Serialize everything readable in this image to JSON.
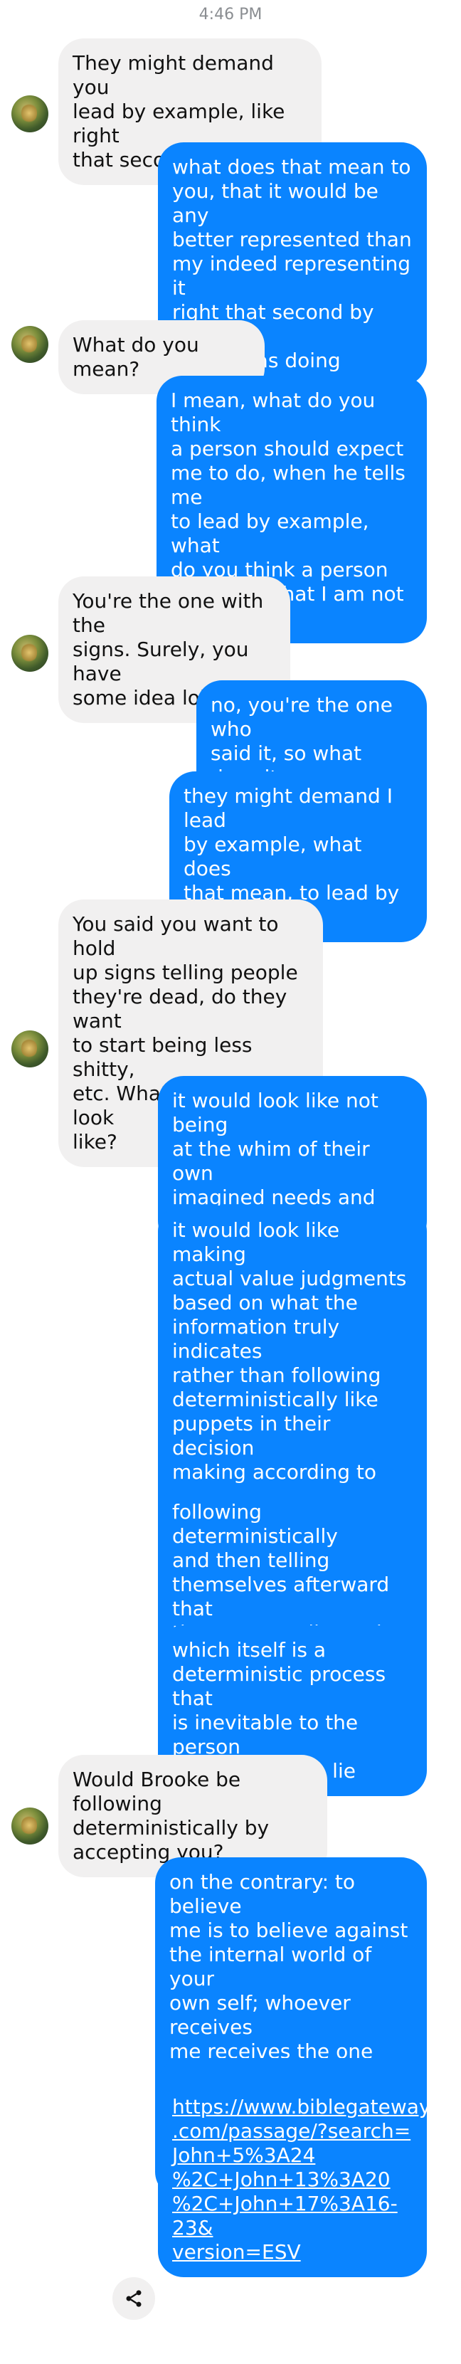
{
  "status_bar": {
    "time": "4:46 PM"
  },
  "messages": [
    {
      "side": "in",
      "text": "They might demand you\nlead by example, like right\nthat second."
    },
    {
      "side": "out",
      "text": "what does that mean to\nyou, that it would be any\nbetter represented than\nmy indeed representing it\nright that second by doing\nwhat I was doing"
    },
    {
      "side": "in",
      "text": "What do you mean?"
    },
    {
      "side": "out",
      "text": "I mean, what do you think\na person should expect\nme to do, when he tells me\nto lead by example, what\ndo you think a person\nshould do that I am not\ndoing"
    },
    {
      "side": "in",
      "text": "You're the one with the\nsigns. Surely, you have\nsome idea lol!"
    },
    {
      "side": "out",
      "text": "no, you're the one who\nsaid it, so what does it\nmean?"
    },
    {
      "side": "out",
      "text": "they might demand I lead\nby example, what does\nthat mean, to lead by\nexample?"
    },
    {
      "side": "in",
      "text": "You said you want to hold\nup signs telling people\nthey're dead, do they want\nto start being less shitty,\netc. What would that look\nlike?"
    },
    {
      "side": "out",
      "text": "it would look like not being\nat the whim of their own\nimagined needs and\nimagined worlds"
    },
    {
      "side": "out",
      "text": "it would look like making\nactual value judgments\nbased on what the\ninformation truly indicates\nrather than following\ndeterministically like\npuppets in their decision\nmaking according to what\ntheir preferences and their\nfeelings and their\nidentities tell them"
    },
    {
      "side": "out",
      "text": "following deterministically\nand then telling\nthemselves afterward that\nthey've actually made\ndecisions"
    },
    {
      "side": "out",
      "text": "which itself is a\ndeterministic process that\nis inevitable to the person\nattached to the lie"
    },
    {
      "side": "in",
      "text": "Would Brooke be following\ndeterministically by\naccepting you?"
    },
    {
      "side": "out",
      "text": "on the contrary: to believe\nme is to believe against\nthe internal world of your\nown self; whoever receives\nme receives the one who\nsent me; every person who\naccepts me becomes alive"
    },
    {
      "side": "out",
      "text": "https://www.biblegateway\n.com/passage/?search=\nJohn+5%3A24\n%2C+John+13%3A20\n%2C+John+17%3A16-23&\nversion=ESV"
    }
  ],
  "share_icon": "share-icon"
}
